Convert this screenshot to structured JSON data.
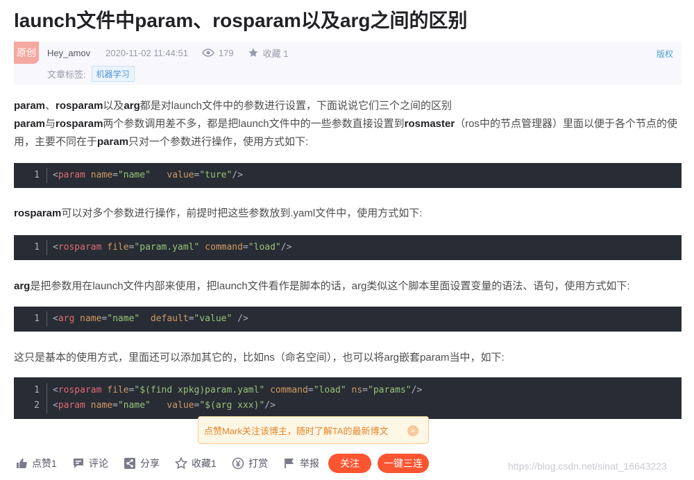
{
  "article": {
    "title": "launch文件中param、rosparam以及arg之间的区别"
  },
  "meta": {
    "badge": "原创",
    "author": "Hey_amov",
    "date": "2020-11-02 11:44:51",
    "views": "179",
    "favorite_label": "收藏 1",
    "copyright": "版权",
    "tags_label": "文章标签:",
    "tag": "机器学习"
  },
  "body": {
    "p1": [
      {
        "b": "param"
      },
      {
        "t": "、"
      },
      {
        "b": "rosparam"
      },
      {
        "t": "以及"
      },
      {
        "b": "arg"
      },
      {
        "t": "都是对launch文件中的参数进行设置，下面说说它们三个之间的区别"
      },
      {
        "br": true
      },
      {
        "b": "param"
      },
      {
        "t": "与"
      },
      {
        "b": "rosparam"
      },
      {
        "t": "两个参数调用差不多，都是把launch文件中的一些参数直接设置到"
      },
      {
        "b": "rosmaster"
      },
      {
        "t": "（ros中的节点管理器）里面以便于各个节点的使用，主要不同在于"
      },
      {
        "b": "param"
      },
      {
        "t": "只对一个参数进行操作，使用方式如下:"
      }
    ],
    "p2": [
      {
        "b": "rosparam"
      },
      {
        "t": "可以对多个参数进行操作，前提时把这些参数放到.yaml文件中，使用方式如下:"
      }
    ],
    "p3": [
      {
        "b": "arg"
      },
      {
        "t": "是把参数用在launch文件内部来使用，把launch文件看作是脚本的话，arg类似这个脚本里面设置变量的语法、语句，使用方式如下:"
      }
    ],
    "p4": [
      {
        "t": "这只是基本的使用方式，里面还可以添加其它的，比如ns（命名空间），也可以将arg嵌套param当中，如下:"
      }
    ]
  },
  "code_blocks": [
    {
      "lines": [
        [
          {
            "k": "pun",
            "v": "<"
          },
          {
            "k": "tag",
            "v": "param"
          },
          {
            "k": "pun",
            "v": " "
          },
          {
            "k": "attr",
            "v": "name"
          },
          {
            "k": "pun",
            "v": "="
          },
          {
            "k": "str",
            "v": "\"name\""
          },
          {
            "k": "pun",
            "v": "   "
          },
          {
            "k": "attr",
            "v": "value"
          },
          {
            "k": "pun",
            "v": "="
          },
          {
            "k": "str",
            "v": "\"ture\""
          },
          {
            "k": "pun",
            "v": "/>"
          }
        ]
      ]
    },
    {
      "lines": [
        [
          {
            "k": "pun",
            "v": "<"
          },
          {
            "k": "tag",
            "v": "rosparam"
          },
          {
            "k": "pun",
            "v": " "
          },
          {
            "k": "attr",
            "v": "file"
          },
          {
            "k": "pun",
            "v": "="
          },
          {
            "k": "str",
            "v": "\"param.yaml\""
          },
          {
            "k": "pun",
            "v": " "
          },
          {
            "k": "attr",
            "v": "command"
          },
          {
            "k": "pun",
            "v": "="
          },
          {
            "k": "str",
            "v": "\"load\""
          },
          {
            "k": "pun",
            "v": "/>"
          }
        ]
      ]
    },
    {
      "lines": [
        [
          {
            "k": "pun",
            "v": "<"
          },
          {
            "k": "tag",
            "v": "arg"
          },
          {
            "k": "pun",
            "v": " "
          },
          {
            "k": "attr",
            "v": "name"
          },
          {
            "k": "pun",
            "v": "="
          },
          {
            "k": "str",
            "v": "\"name\""
          },
          {
            "k": "pun",
            "v": "  "
          },
          {
            "k": "attr",
            "v": "default"
          },
          {
            "k": "pun",
            "v": "="
          },
          {
            "k": "str",
            "v": "\"value\""
          },
          {
            "k": "pun",
            "v": " />"
          }
        ]
      ]
    },
    {
      "lines": [
        [
          {
            "k": "pun",
            "v": "<"
          },
          {
            "k": "tag",
            "v": "rosparam"
          },
          {
            "k": "pun",
            "v": " "
          },
          {
            "k": "attr",
            "v": "file"
          },
          {
            "k": "pun",
            "v": "="
          },
          {
            "k": "str",
            "v": "\"$(find xpkg)param.yaml\""
          },
          {
            "k": "pun",
            "v": " "
          },
          {
            "k": "attr",
            "v": "command"
          },
          {
            "k": "pun",
            "v": "="
          },
          {
            "k": "str",
            "v": "\"load\""
          },
          {
            "k": "pun",
            "v": " "
          },
          {
            "k": "attr",
            "v": "ns"
          },
          {
            "k": "pun",
            "v": "="
          },
          {
            "k": "str",
            "v": "\"params\""
          },
          {
            "k": "pun",
            "v": "/>"
          }
        ],
        [
          {
            "k": "pun",
            "v": "<"
          },
          {
            "k": "tag",
            "v": "param"
          },
          {
            "k": "pun",
            "v": " "
          },
          {
            "k": "attr",
            "v": "name"
          },
          {
            "k": "pun",
            "v": "="
          },
          {
            "k": "str",
            "v": "\"name\""
          },
          {
            "k": "pun",
            "v": "   "
          },
          {
            "k": "attr",
            "v": "value"
          },
          {
            "k": "pun",
            "v": "="
          },
          {
            "k": "str",
            "v": "\"$(arg xxx)\""
          },
          {
            "k": "pun",
            "v": "/>"
          }
        ]
      ]
    }
  ],
  "toast": {
    "text": "点赞Mark关注该博主，随时了解TA的最新博文",
    "close_glyph": "×"
  },
  "toolbar": {
    "like": "点赞1",
    "comment": "评论",
    "share": "分享",
    "favorite": "收藏1",
    "reward": "打赏",
    "report": "举报",
    "follow": "关注",
    "triple": "一键三连"
  },
  "watermark": "https://blog.csdn.net/sinat_16643223",
  "colors": {
    "accent": "#fc5531",
    "code_bg": "#282c34",
    "link": "#4ea1db"
  }
}
